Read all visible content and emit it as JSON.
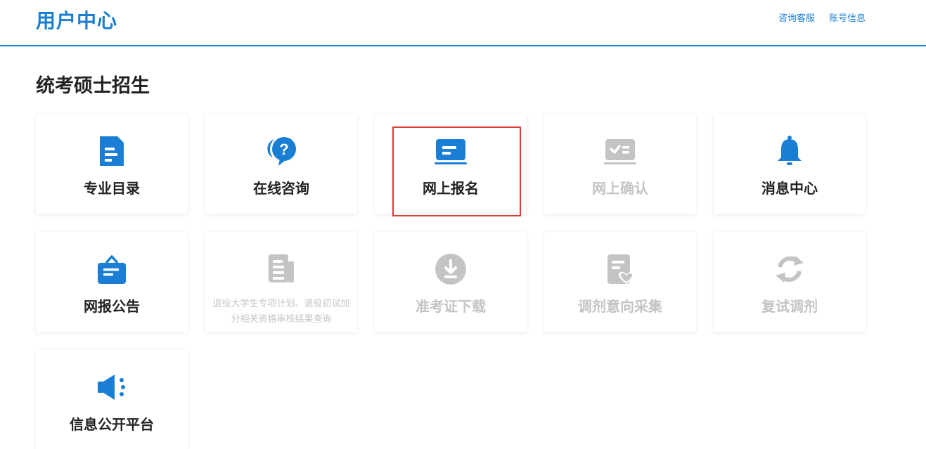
{
  "header": {
    "title": "用户中心",
    "links": [
      "咨询客服",
      "账号信息"
    ]
  },
  "section": {
    "title": "统考硕士招生"
  },
  "cards": [
    {
      "label": "专业目录",
      "icon": "document-icon",
      "enabled": true
    },
    {
      "label": "在线咨询",
      "icon": "question-chat-icon",
      "enabled": true
    },
    {
      "label": "网上报名",
      "icon": "laptop-icon",
      "enabled": true,
      "highlighted": true
    },
    {
      "label": "网上确认",
      "icon": "laptop-check-icon",
      "enabled": false
    },
    {
      "label": "消息中心",
      "icon": "bell-icon",
      "enabled": true
    },
    {
      "label": "网报公告",
      "icon": "notice-bag-icon",
      "enabled": true
    },
    {
      "label": "退役大学生专项计划、退役初试加分相关资格审核结果查询",
      "icon": "report-icon",
      "enabled": false
    },
    {
      "label": "准考证下载",
      "icon": "download-icon",
      "enabled": false
    },
    {
      "label": "调剂意向采集",
      "icon": "form-heart-icon",
      "enabled": false
    },
    {
      "label": "复试调剂",
      "icon": "refresh-icon",
      "enabled": false
    },
    {
      "label": "信息公开平台",
      "icon": "megaphone-icon",
      "enabled": true
    }
  ],
  "colors": {
    "accent": "#1a7fd4",
    "disabled": "#c4c4c4",
    "highlight": "#d9403a"
  }
}
